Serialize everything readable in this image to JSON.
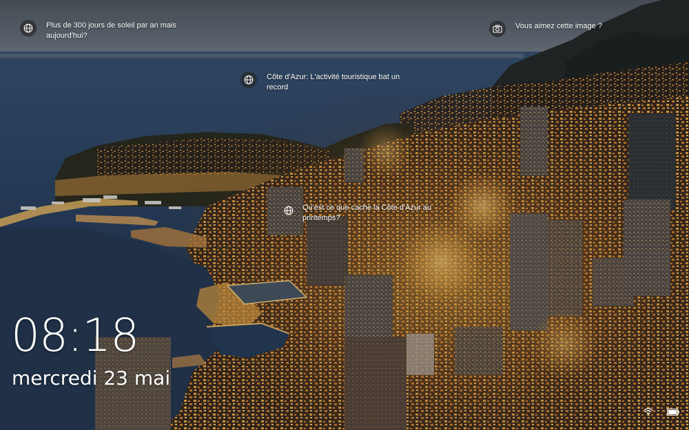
{
  "lock_screen": {
    "hotspots": [
      {
        "text": "Plus de 300 jours de soleil par an mais aujourd'hui?",
        "icon": "globe-icon"
      },
      {
        "text": "Vous aimez cette image ?",
        "icon": "camera-icon"
      },
      {
        "text": "Côte d'Azur: L'activité touristique bat un record",
        "icon": "globe-icon"
      },
      {
        "text": "Qu'est ce que cache la Côte d'Azur au printemps?",
        "icon": "globe-icon"
      }
    ],
    "time": "08:18",
    "date": "mercredi 23 mai",
    "status_icons": [
      "wifi-icon",
      "battery-icon"
    ]
  },
  "colors": {
    "sea": "#2b3f5c",
    "sky_top": "#5a6470",
    "city_lights": "#f0a838",
    "mountain": "#262a2a",
    "text": "#ffffff"
  }
}
